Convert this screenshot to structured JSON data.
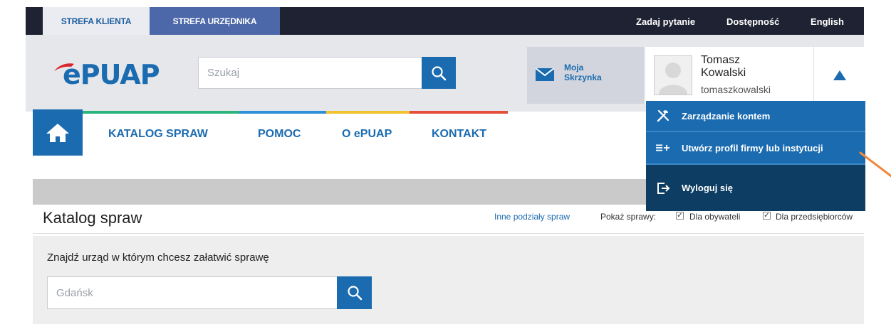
{
  "topbar": {
    "tab_klient": "STREFA KLIENTA",
    "tab_urzednik": "STREFA URZĘDNIKA",
    "links": [
      "Zadaj pytanie",
      "Dostępność",
      "English"
    ]
  },
  "header": {
    "logo_text": "ePUAP",
    "search_placeholder": "Szukaj",
    "mailbox_label_1": "Moja",
    "mailbox_label_2": "Skrzynka",
    "user_first": "Tomasz",
    "user_last": "Kowalski",
    "user_login": "tomaszkowalski"
  },
  "nav": {
    "items": [
      "KATALOG SPRAW",
      "POMOC",
      "O ePUAP",
      "KONTAKT"
    ]
  },
  "dropdown": {
    "items": [
      "Zarządzanie kontem",
      "Utwórz profil firmy lub instytucji",
      "Wyloguj się"
    ]
  },
  "main": {
    "title": "Katalog spraw",
    "other_link": "Inne podziały spraw",
    "show_label": "Pokaż sprawy:",
    "filter_1": "Dla obywateli",
    "filter_2": "Dla przedsiębiorców",
    "panel_label": "Znajdź urząd w którym chcesz załatwić sprawę",
    "panel_value": "Gdańsk"
  },
  "colors": {
    "brand_blue": "#1b6bb0",
    "dark": "#1f2232",
    "logo_red": "#d8262b",
    "arrow_orange": "#f0893a"
  }
}
